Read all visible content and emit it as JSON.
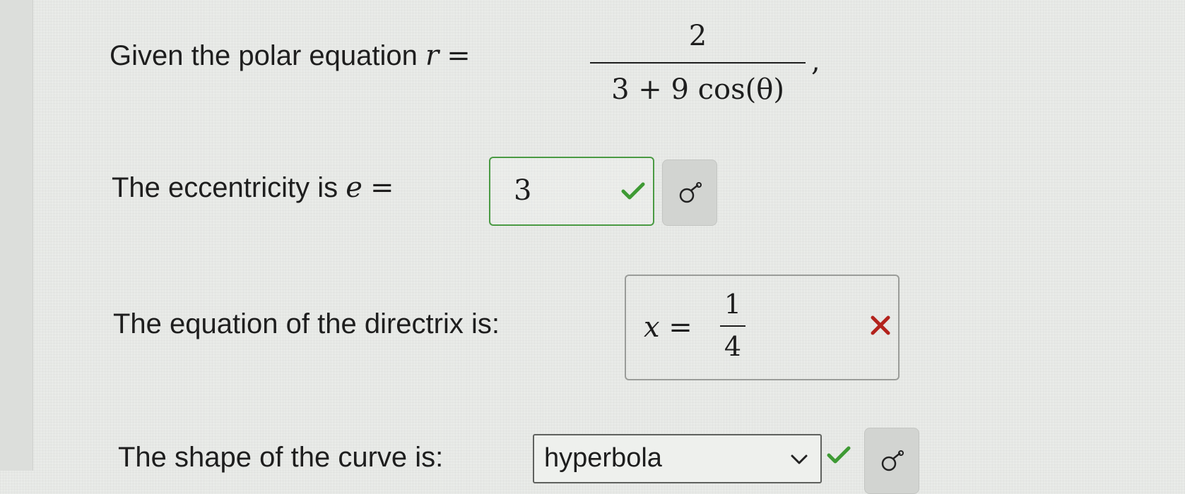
{
  "question": {
    "intro": "Given the polar equation",
    "r_var": "r",
    "equals": "=",
    "numerator": "2",
    "denominator": "3 + 9 cos(θ)",
    "comma": ","
  },
  "eccentricity": {
    "label": "The eccentricity is",
    "var": "e",
    "equals": "=",
    "value": "3",
    "status": "correct"
  },
  "directrix": {
    "label": "The equation of the directrix is:",
    "lhs": "x =",
    "numerator": "1",
    "denominator": "4",
    "status": "incorrect"
  },
  "shape": {
    "label": "The shape of the curve is:",
    "selected": "hyperbola",
    "status": "correct"
  },
  "icons": {
    "correct": "checkmark-icon",
    "incorrect": "x-mark-icon",
    "preview": "preview-icon",
    "dropdown": "chevron-down-icon"
  },
  "colors": {
    "correct": "#3e9a34",
    "incorrect": "#b3231d"
  }
}
